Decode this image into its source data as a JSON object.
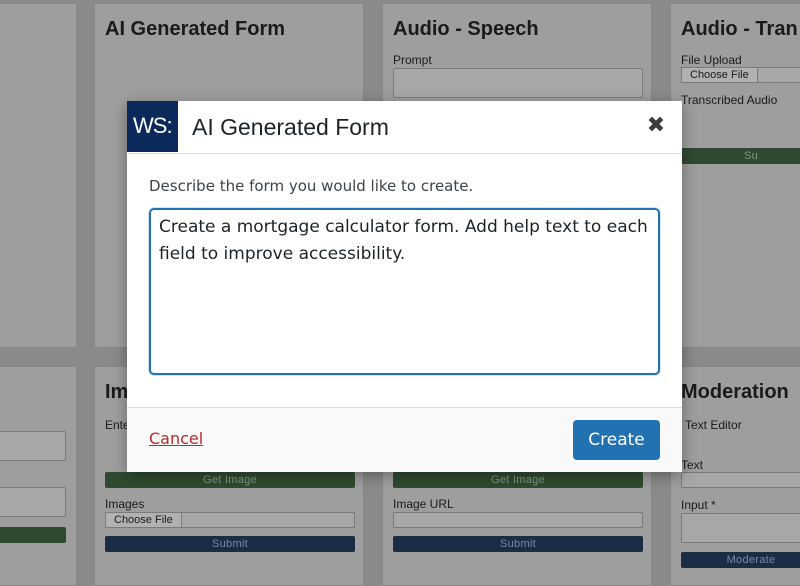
{
  "background": {
    "cards": [
      {
        "title": "AI Generated Form"
      },
      {
        "title": "Audio - Speech",
        "fields": [
          "Prompt"
        ]
      },
      {
        "title": "Audio - Tran",
        "fields": [
          "File Upload",
          "Transcribed Audio"
        ],
        "file_button": "Choose File",
        "button_fragment": "Su"
      },
      {
        "title": "Im",
        "fields": [
          "Ente",
          "Images"
        ],
        "get_image": "Get Image",
        "file_button": "Choose File",
        "submit": "Submit"
      },
      {
        "fields": [
          "Image URL"
        ],
        "get_image": "Get Image",
        "submit": "Submit"
      },
      {
        "title": "Moderation",
        "fields": [
          "Text Editor",
          "Text",
          "Input *"
        ],
        "moderate": "Moderate"
      }
    ]
  },
  "modal": {
    "logo": "WS:",
    "title": "AI Generated Form",
    "close_symbol": "✖",
    "description": "Describe the form you would like to create.",
    "prompt_value": "Create a mortgage calculator form. Add help text to each field to improve accessibility.",
    "cancel_label": "Cancel",
    "create_label": "Create"
  },
  "colors": {
    "primary": "#2271b1",
    "cancel": "#b32d2e",
    "logo_bg": "#0b2a5b"
  }
}
